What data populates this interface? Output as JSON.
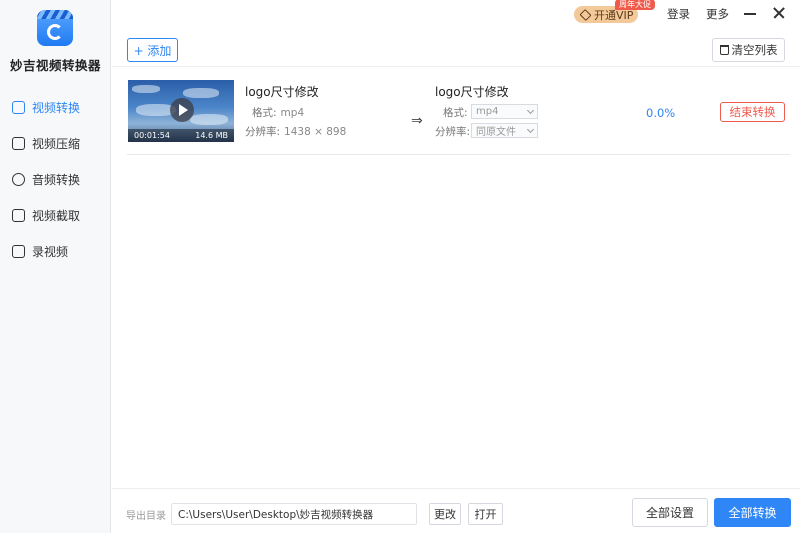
{
  "app": {
    "name": "妙吉视频转换器"
  },
  "sidebar": {
    "items": [
      {
        "label": "视频转换",
        "icon": "video-convert-icon",
        "active": true
      },
      {
        "label": "视频压缩",
        "icon": "compress-icon",
        "active": false
      },
      {
        "label": "音频转换",
        "icon": "audio-icon",
        "active": false
      },
      {
        "label": "视频截取",
        "icon": "cut-icon",
        "active": false
      },
      {
        "label": "录视频",
        "icon": "record-icon",
        "active": false
      }
    ]
  },
  "titlebar": {
    "vip_label": "开通VIP",
    "promo_badge": "周年大促",
    "login_label": "登录",
    "more_label": "更多"
  },
  "toolbar": {
    "add_label": "+ 添加",
    "clear_label": "清空列表"
  },
  "file": {
    "name": "logo尺寸修改",
    "duration": "00:01:54",
    "size": "14.6 MB",
    "format_label": "格式:",
    "format": "mp4",
    "resolution_label": "分辨率:",
    "resolution": "1438 × 898",
    "arrow": "⇒",
    "output_name": "logo尺寸修改",
    "output_format_label": "格式:",
    "output_format": "mp4",
    "output_resolution_label": "分辨率:",
    "output_resolution": "同原文件",
    "progress": "0.0%",
    "end_label": "结束转换"
  },
  "bottom": {
    "output_dir_label": "导出目录",
    "output_path": "C:\\Users\\User\\Desktop\\妙吉视频转换器",
    "change_label": "更改",
    "open_label": "打开",
    "all_settings_label": "全部设置",
    "convert_all_label": "全部转换"
  },
  "colors": {
    "accent": "#2f86f6",
    "danger": "#ef5a4d",
    "vip": "#f3c99a"
  }
}
